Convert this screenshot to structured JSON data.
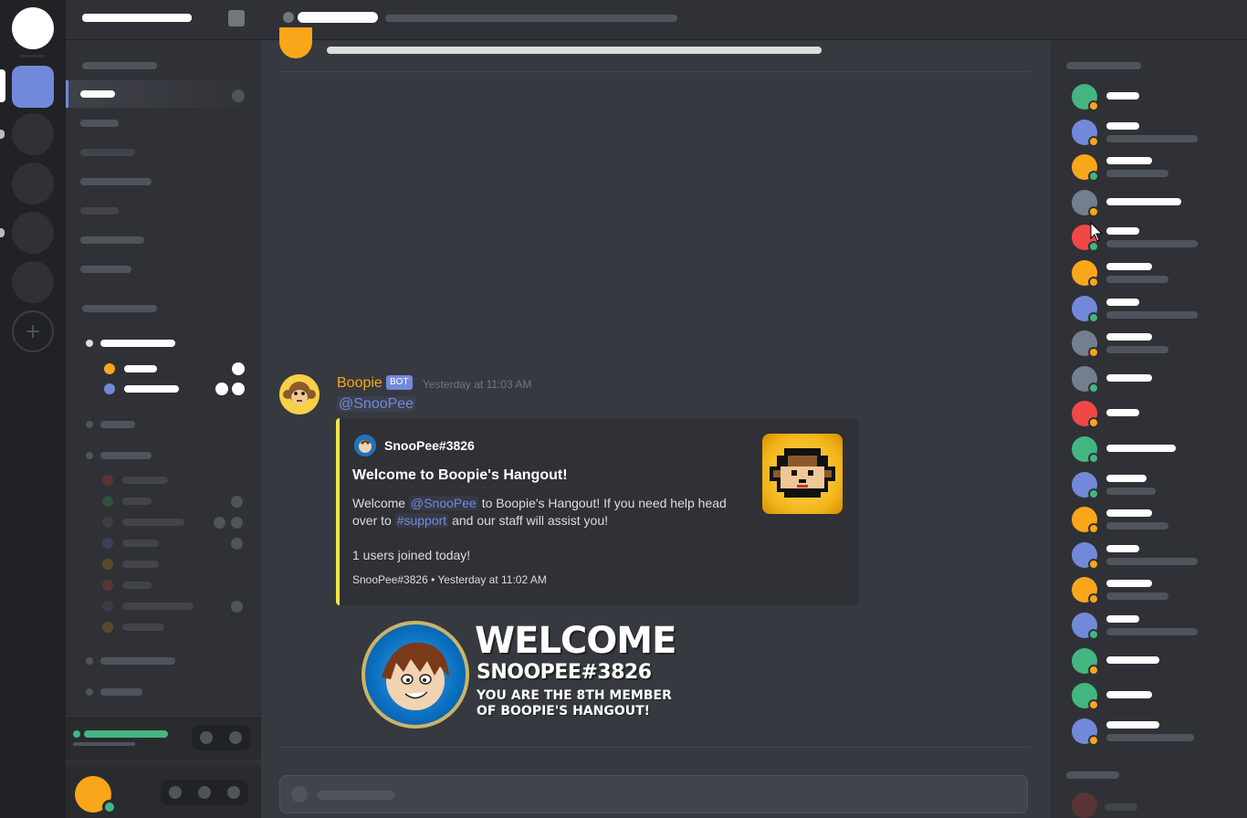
{
  "message": {
    "author": "Boopie",
    "bot_tag": "BOT",
    "timestamp": "Yesterday at 11:03 AM",
    "mention": "@SnooPee"
  },
  "embed": {
    "author": "SnooPee#3826",
    "title": "Welcome to Boopie's Hangout!",
    "desc_prefix": "Welcome ",
    "desc_mention": "@SnooPee",
    "desc_mid": " to Boopie's Hangout! If you need help head over to ",
    "desc_channel": "#support",
    "desc_suffix": " and our staff will assist you!",
    "joined": "1 users joined today!",
    "footer": "SnooPee#3826 • Yesterday at 11:02 AM",
    "accent_color": "#f5e642"
  },
  "welcome_card": {
    "heading": "WELCOME",
    "username": "SNOOPEE#3826",
    "line1": "YOU ARE THE 8TH MEMBER",
    "line2": "OF BOOPIE'S HANGOUT!"
  },
  "colors": {
    "online": "#43b581",
    "idle": "#faa61a",
    "blurple": "#7289da",
    "red": "#f04747",
    "grey": "#747f8d"
  },
  "icons": {
    "add_server": "plus-icon"
  }
}
